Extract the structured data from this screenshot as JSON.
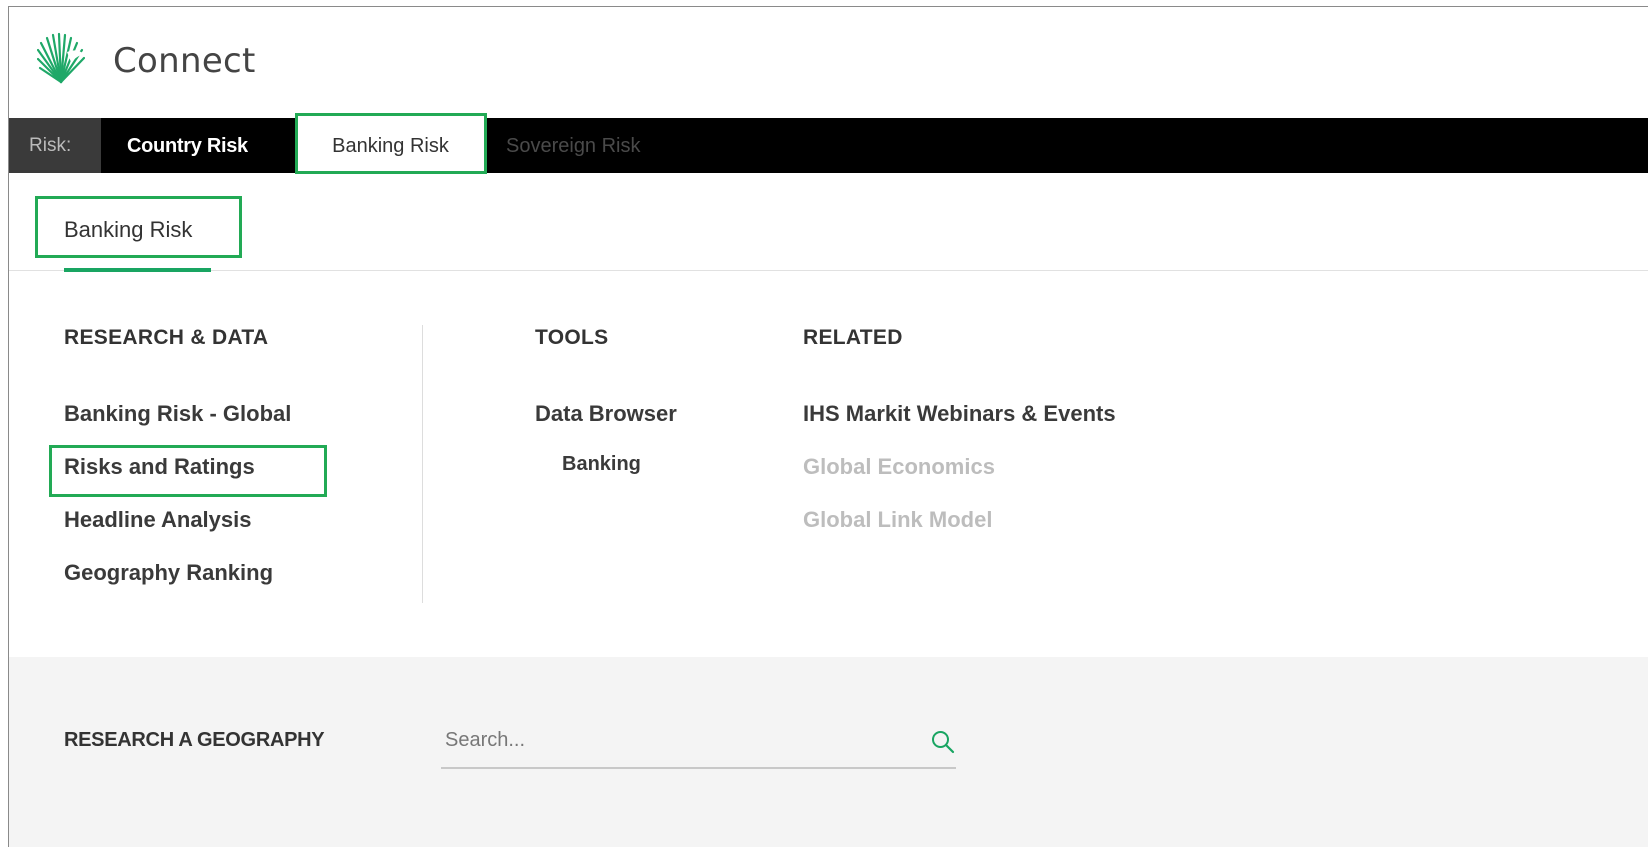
{
  "app": {
    "title": "Connect"
  },
  "nav": {
    "prefix": "Risk:",
    "tabs": [
      "Country Risk",
      "Banking Risk",
      "Sovereign Risk"
    ],
    "active_tab": "Banking Risk"
  },
  "subnav": {
    "tab": "Banking Risk"
  },
  "menu": {
    "research": {
      "heading": "RESEARCH & DATA",
      "items": [
        "Banking Risk - Global",
        "Risks and Ratings",
        "Headline Analysis",
        "Geography Ranking"
      ]
    },
    "tools": {
      "heading": "TOOLS",
      "items": [
        "Data Browser",
        "Banking"
      ]
    },
    "related": {
      "heading": "RELATED",
      "items": [
        "IHS Markit Webinars & Events",
        "Global Economics",
        "Global Link Model"
      ]
    }
  },
  "geography": {
    "label": "RESEARCH A GEOGRAPHY",
    "search_placeholder": "Search...",
    "search_value": ""
  },
  "colors": {
    "accent": "#19a562",
    "highlight": "#22aa55",
    "nav_background": "#000000",
    "disabled_text": "#bdbdbd"
  },
  "icons": [
    "connect-logo",
    "search-icon"
  ]
}
